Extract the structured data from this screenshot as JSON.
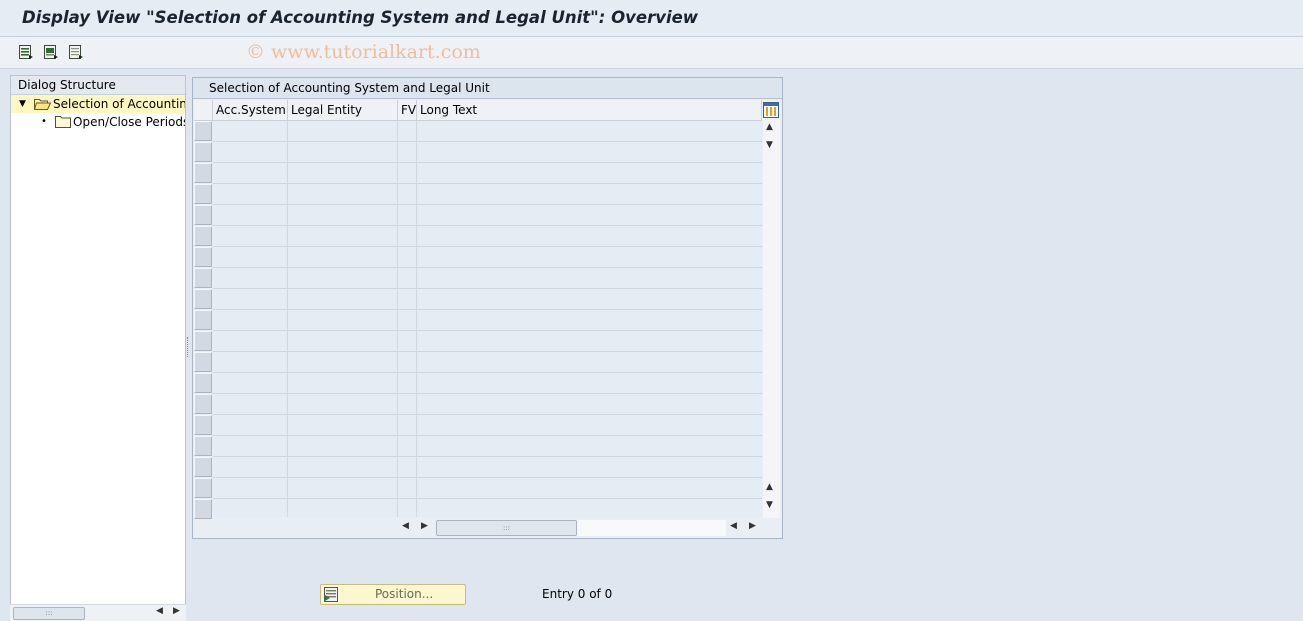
{
  "window": {
    "title": "Display View \"Selection of Accounting System and Legal Unit\": Overview"
  },
  "toolbar": {
    "watermark": "© www.tutorialkart.com",
    "buttons": [
      {
        "icon": "select-all-icon"
      },
      {
        "icon": "select-block-icon"
      },
      {
        "icon": "deselect-all-icon"
      }
    ]
  },
  "dialog_structure": {
    "header": "Dialog Structure",
    "items": [
      {
        "label": "Selection of Accounting",
        "expanded": true,
        "selected": true
      },
      {
        "label": "Open/Close Periods D",
        "expanded": false,
        "selected": false
      }
    ]
  },
  "table": {
    "title": "Selection of Accounting System and Legal Unit",
    "columns": [
      "Acc.System",
      "Legal Entity",
      "FV",
      "Long Text"
    ],
    "rows": []
  },
  "footer": {
    "position_button": "Position...",
    "entry_text": "Entry 0 of 0"
  },
  "colors": {
    "selected_row": "#fff7c2",
    "table_cell_bg": "#e6ecf3",
    "button_bg": "#fbf7d0"
  }
}
